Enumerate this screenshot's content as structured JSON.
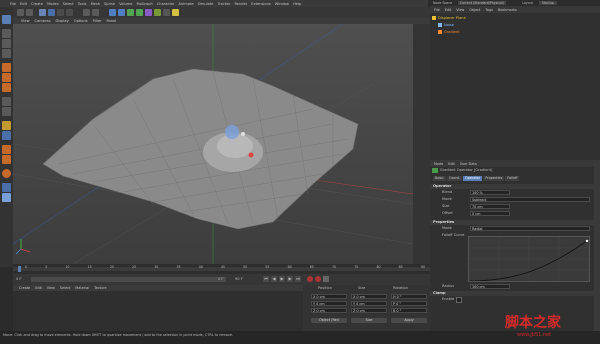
{
  "menubar": {
    "items": [
      "File",
      "Edit",
      "Create",
      "Modes",
      "Select",
      "Tools",
      "Mesh",
      "Spline",
      "Volume",
      "MoGraph",
      "Character",
      "Animate",
      "Simulate",
      "Tracker",
      "Render",
      "Extensions",
      "Window",
      "Help"
    ]
  },
  "viewport_menu": {
    "items": [
      "View",
      "Cameras",
      "Display",
      "Options",
      "Filter",
      "Panel"
    ]
  },
  "object_manager": {
    "top_labels": [
      "Node Space",
      "Current (Standard/Physical)",
      "Layout",
      "Startup"
    ],
    "menu": [
      "File",
      "Edit",
      "View",
      "Object",
      "Tags",
      "Bookmarks"
    ],
    "objects": [
      {
        "name": "Displacer Plane",
        "color": "#e8c030"
      },
      {
        "name": "Noise",
        "color": "#7fb8ff"
      },
      {
        "name": "Gradient",
        "color": "#ff8a30"
      }
    ]
  },
  "attributes": {
    "menu": [
      "Mode",
      "Edit",
      "User Data"
    ],
    "title": "Gradient Operator [Gradient]",
    "tabs": [
      "Basic",
      "Coord.",
      "Operator",
      "Properties",
      "Falloff"
    ],
    "active_tab": "Operator",
    "operator_label": "Operator",
    "fields": [
      {
        "label": "Blend",
        "value": "100 %"
      },
      {
        "label": "Mode",
        "value": "Subtract"
      },
      {
        "label": "Size",
        "value": "70 cm"
      },
      {
        "label": "Offset",
        "value": "0 cm"
      }
    ],
    "properties_label": "Properties",
    "prop_fields": [
      {
        "label": "Mode",
        "value": "Radial"
      },
      {
        "label": "Falloff Curve",
        "value": ""
      }
    ],
    "radius_label": "Radius",
    "radius_value": "100 cm",
    "clamp_label": "Clamp",
    "enable_label": "Enable"
  },
  "timeline": {
    "start": "0 F",
    "end": "90 F",
    "ticks": [
      "0",
      "5",
      "10",
      "15",
      "20",
      "25",
      "30",
      "35",
      "40",
      "45",
      "50",
      "55",
      "60",
      "65",
      "70",
      "75",
      "80",
      "85",
      "90"
    ],
    "current_frame": "0 F",
    "end_frame": "90 F"
  },
  "material_manager": {
    "menu": [
      "Create",
      "Edit",
      "View",
      "Select",
      "Material",
      "Texture"
    ]
  },
  "coordinates": {
    "headers": [
      "Position",
      "Size",
      "Rotation"
    ],
    "rows": [
      {
        "pos": "X  0 cm",
        "size": "X  0 cm",
        "rot": "H  0 °"
      },
      {
        "pos": "Y  0 cm",
        "size": "Y  0 cm",
        "rot": "P  0 °"
      },
      {
        "pos": "Z  0 cm",
        "size": "Z  0 cm",
        "rot": "B  0 °"
      }
    ],
    "object_mode": "Object (Rel)",
    "size_mode": "Size",
    "apply_label": "Apply"
  },
  "statusbar": {
    "text": "Move: Click and drag to move elements. Hold down SHIFT to quantize movement / add to the selection in point mode, CTRL to remove."
  },
  "watermark": {
    "title": "脚本之家",
    "url": "www.jb51.net"
  },
  "colors": {
    "accent": "#5a7fb5",
    "axis_x": "#d44",
    "axis_y": "#4c4",
    "axis_z": "#48f"
  }
}
